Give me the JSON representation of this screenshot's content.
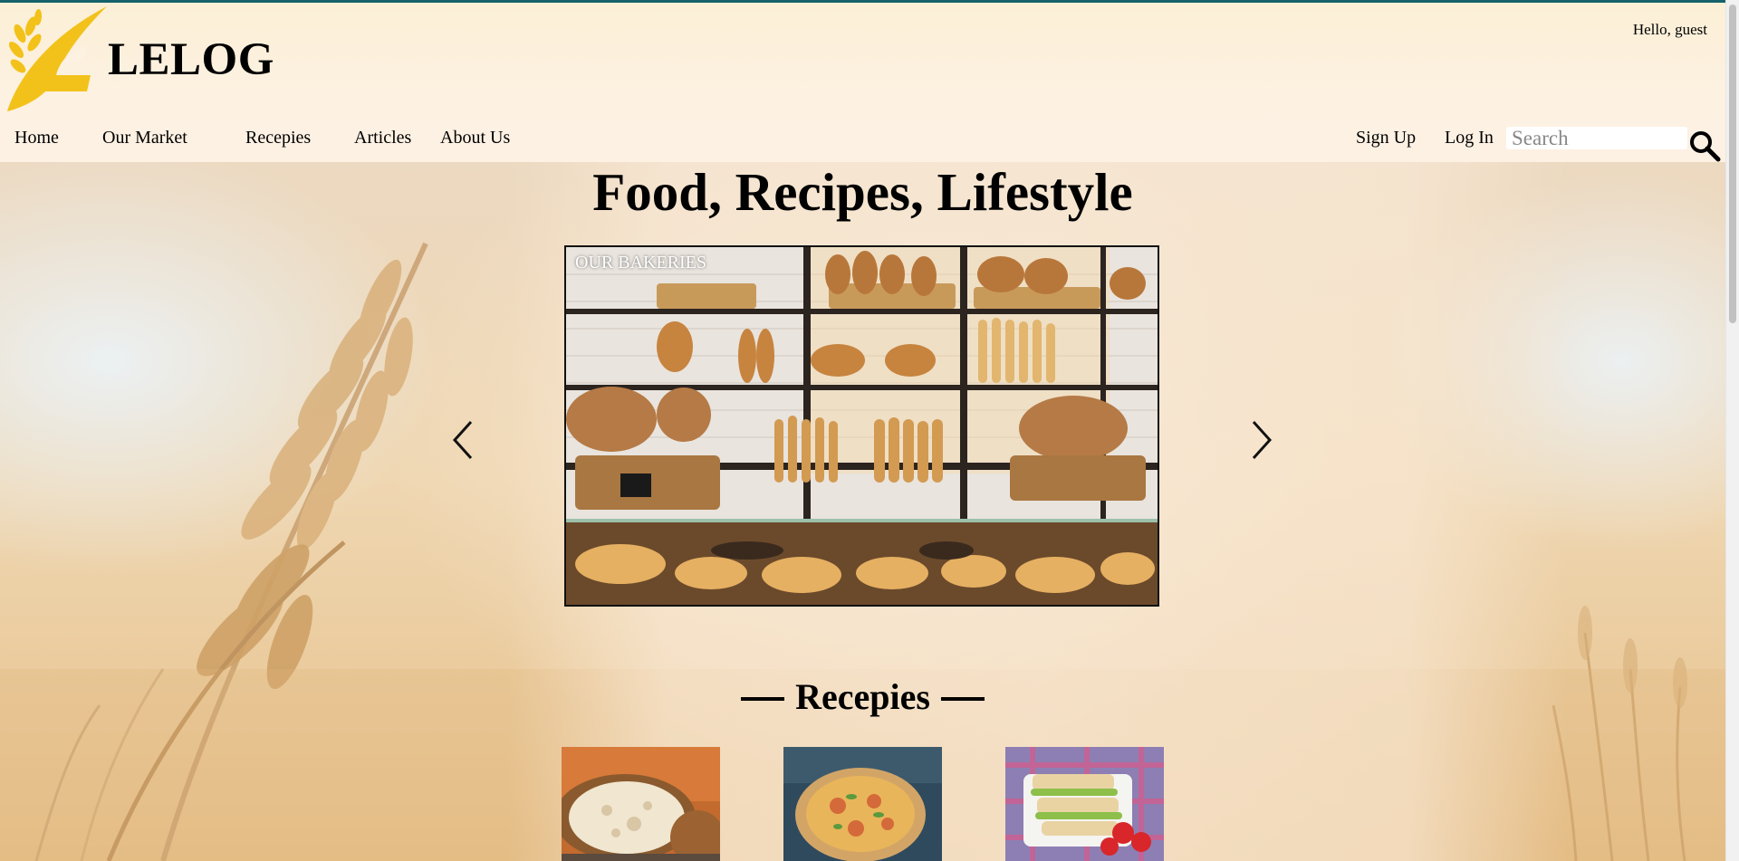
{
  "brand": {
    "name": "LELOG",
    "logo_icon": "wheat-check-logo",
    "accent": "#f2c21b"
  },
  "greeting": "Hello, guest",
  "nav": {
    "items": [
      {
        "label": "Home"
      },
      {
        "label": "Our Market"
      },
      {
        "label": "Recepies"
      },
      {
        "label": "Articles"
      },
      {
        "label": "About Us"
      }
    ],
    "signup": "Sign Up",
    "login": "Log In"
  },
  "search": {
    "placeholder": "Search",
    "icon": "magnifier-icon"
  },
  "hero": {
    "title": "Food, Recipes, Lifestyle",
    "carousel": {
      "caption": "OUR BAKERIES",
      "prev_icon": "chevron-left-icon",
      "next_icon": "chevron-right-icon"
    }
  },
  "recipes": {
    "title": "Recepies",
    "cards": [
      {
        "image": "bread-loaf"
      },
      {
        "image": "pizza"
      },
      {
        "image": "sandwich"
      }
    ]
  },
  "colors": {
    "topline": "#16626a",
    "header_bg": "#fdf1e2",
    "text": "#000000"
  }
}
